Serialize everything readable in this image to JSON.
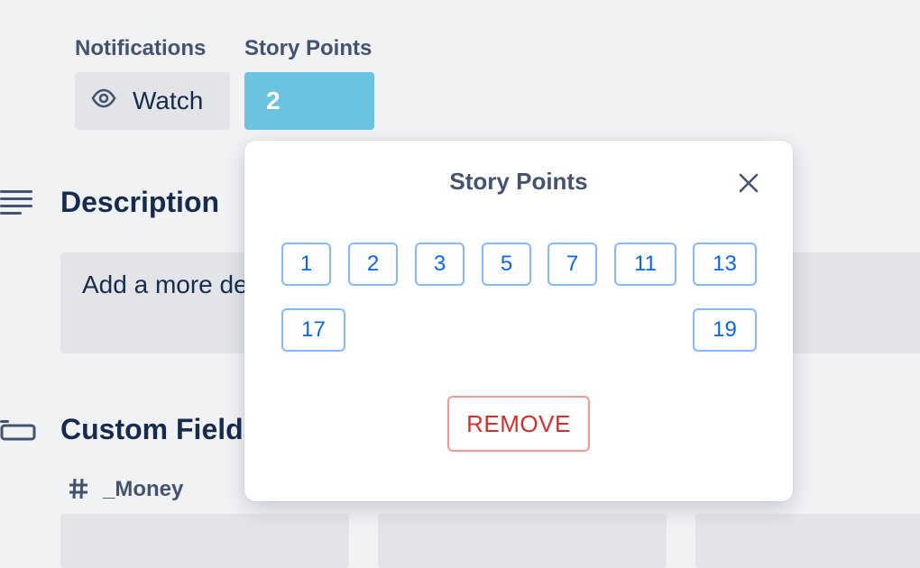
{
  "header": {
    "notifications_label": "Notifications",
    "story_points_label": "Story Points",
    "watch_label": "Watch",
    "story_points_value": "2"
  },
  "description": {
    "heading": "Description",
    "placeholder": "Add a more de"
  },
  "custom_fields": {
    "heading": "Custom Fields",
    "money_label": "_Money"
  },
  "popover": {
    "title": "Story Points",
    "options": [
      "1",
      "2",
      "3",
      "5",
      "7",
      "11",
      "13",
      "17",
      "19"
    ],
    "remove_label": "REMOVE"
  },
  "colors": {
    "accent": "#6cc3e0",
    "option_border": "#85b8ff",
    "option_text": "#0c66e4",
    "remove": "#d32f2f"
  },
  "icons": {
    "watch": "eye-icon",
    "description": "text-lines-icon",
    "custom_fields": "field-card-icon",
    "money": "hash-icon",
    "close": "close-icon"
  }
}
